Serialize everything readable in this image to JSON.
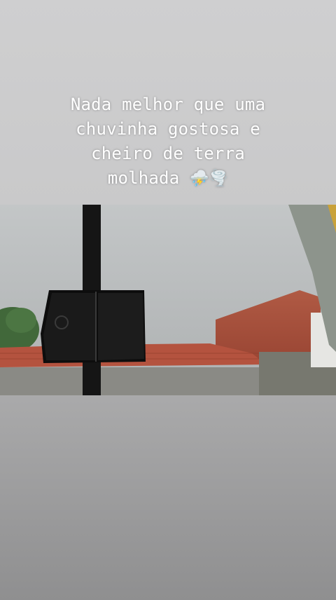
{
  "story": {
    "caption_lines": [
      "Nada melhor que uma",
      "chuvinha gostosa e",
      "cheiro de terra",
      "molhada"
    ],
    "caption_emojis": {
      "storm": "⛈️",
      "tornado": "🌪️"
    }
  },
  "colors": {
    "sky": "#b9bcbd",
    "roof": "#b5513d",
    "wall": "#a5452f",
    "pole": "#141414",
    "tree": "#3f6a38"
  }
}
